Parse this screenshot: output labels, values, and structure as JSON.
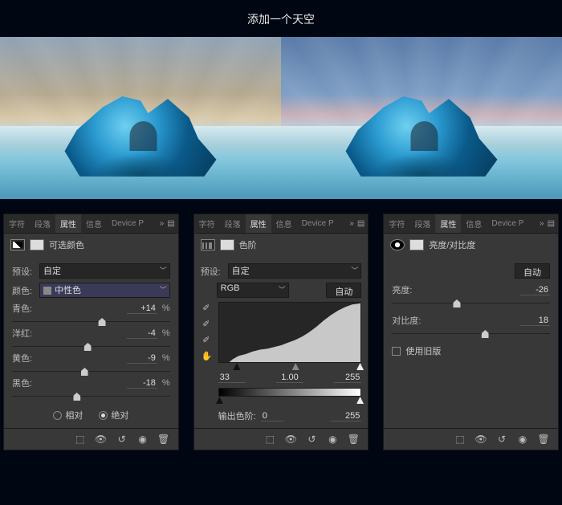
{
  "title": "添加一个天空",
  "tabs": {
    "t0": "字符",
    "t1": "段落",
    "t2": "属性",
    "t3": "信息",
    "t4": "Device P"
  },
  "panel1": {
    "name": "可选颜色",
    "preset_label": "预设:",
    "preset": "自定",
    "color_label": "颜色:",
    "color": "中性色",
    "cyan_label": "青色:",
    "cyan": "+14",
    "magenta_label": "洋红:",
    "magenta": "-4",
    "yellow_label": "黄色:",
    "yellow": "-9",
    "black_label": "黑色:",
    "black": "-18",
    "pct": "%",
    "relative": "相对",
    "absolute": "绝对"
  },
  "panel2": {
    "name": "色阶",
    "preset_label": "预设:",
    "preset": "自定",
    "channel": "RGB",
    "auto": "自动",
    "in_black": "33",
    "in_gamma": "1.00",
    "in_white": "255",
    "out_label": "输出色阶:",
    "out_black": "0",
    "out_white": "255"
  },
  "panel3": {
    "name": "亮度/对比度",
    "auto": "自动",
    "bright_label": "亮度:",
    "bright": "-26",
    "contrast_label": "对比度:",
    "contrast": "18",
    "legacy": "使用旧版"
  }
}
